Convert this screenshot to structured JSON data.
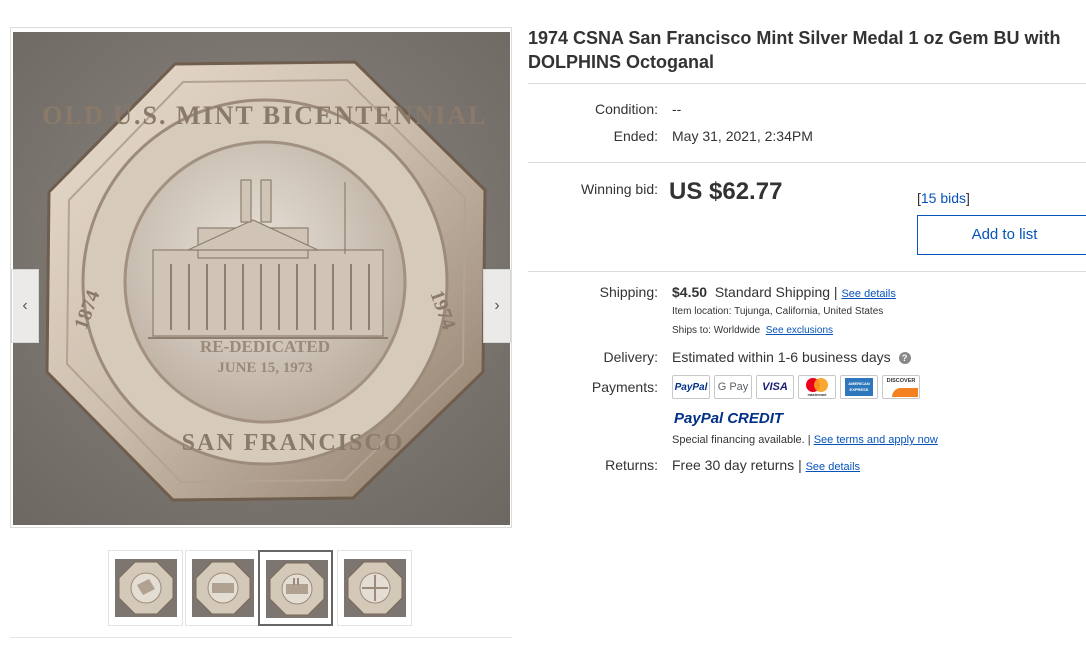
{
  "gallery": {
    "coin_text_top": "OLD U.S. MINT BICENTENNIAL",
    "coin_text_left": "1874",
    "coin_text_right": "1974",
    "coin_text_bottom": "SAN FRANCISCO",
    "coin_center_line1": "RE-DEDICATED",
    "coin_center_line2": "JUNE 15, 1973",
    "prev_arrow": "‹",
    "next_arrow": "›",
    "thumbnail_count": 4,
    "selected_thumbnail": 3
  },
  "listing": {
    "title": "1974 CSNA San Francisco Mint Silver Medal 1 oz Gem BU with DOLPHINS Octoganal",
    "condition_label": "Condition:",
    "condition_value": "--",
    "ended_label": "Ended:",
    "ended_value": "May 31, 2021, 2:34PM",
    "winning_bid_label": "Winning bid:",
    "winning_bid_value": "US $62.77",
    "bids_open": "[",
    "bids_link": "15 bids",
    "bids_close": "]",
    "add_to_list": "Add to list"
  },
  "shipping": {
    "label": "Shipping:",
    "cost": "$4.50",
    "method": "Standard Shipping",
    "separator": "|",
    "details_link": "See details",
    "item_location_label": "Item location:",
    "item_location": "Tujunga, California, United States",
    "ships_to_label": "Ships to:",
    "ships_to": "Worldwide",
    "exclusions_link": "See exclusions"
  },
  "delivery": {
    "label": "Delivery:",
    "value": "Estimated within 1-6 business days",
    "help_icon": "?"
  },
  "payments": {
    "label": "Payments:",
    "logos": [
      "PayPal",
      "G Pay",
      "VISA",
      "mastercard",
      "AMERICAN EXPRESS",
      "DISCOVER"
    ],
    "paypal_credit_a": "PayPal",
    "paypal_credit_b": "CREDIT",
    "financing_text": "Special financing available.",
    "separator": "|",
    "terms_link": "See terms and apply now"
  },
  "returns": {
    "label": "Returns:",
    "value": "Free 30 day returns",
    "separator": "|",
    "details_link": "See details"
  },
  "colors": {
    "link": "#0654ba",
    "text": "#333333",
    "paypal_dark": "#003087",
    "paypal_light": "#009cde"
  }
}
